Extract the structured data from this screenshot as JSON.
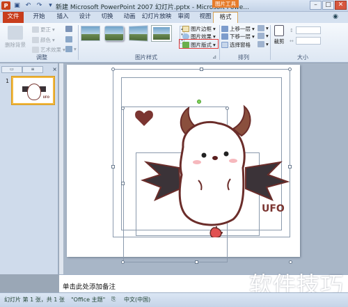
{
  "window": {
    "title": "新建 Microsoft PowerPoint 2007 幻灯片.pptx - Microsoft Powe...",
    "context_tab_header": "图片工具",
    "app_icon": "P",
    "controls": {
      "minimize": "–",
      "maximize": "□",
      "close": "✕"
    }
  },
  "tabs": [
    {
      "label": "文件"
    },
    {
      "label": "开始"
    },
    {
      "label": "插入"
    },
    {
      "label": "设计"
    },
    {
      "label": "切换"
    },
    {
      "label": "动画"
    },
    {
      "label": "幻灯片放映"
    },
    {
      "label": "审阅"
    },
    {
      "label": "视图"
    },
    {
      "label": "格式"
    }
  ],
  "ribbon": {
    "remove_background": "删除背景",
    "corrections": "更正",
    "color": "颜色",
    "artistic_effects": "艺术效果",
    "adjust_group": "调整",
    "picture_styles_group": "图片样式",
    "picture_border": "图片边框",
    "picture_effects": "图片效果",
    "picture_layout": "图片版式",
    "bring_forward": "上移一层",
    "send_backward": "下移一层",
    "selection_pane": "选择窗格",
    "arrange_group": "排列",
    "crop": "裁剪",
    "size_group": "大小"
  },
  "left_panel": {
    "slide_number": "1",
    "close_glyph": "×"
  },
  "slide": {
    "ufo_text": "UFO"
  },
  "notes": {
    "placeholder": "单击此处添加备注"
  },
  "status": {
    "slide_info": "幻灯片 第 1 张，共 1 张",
    "theme": "\"Office 主题\"",
    "language": "中文(中国)"
  },
  "watermark": "软件技巧"
}
